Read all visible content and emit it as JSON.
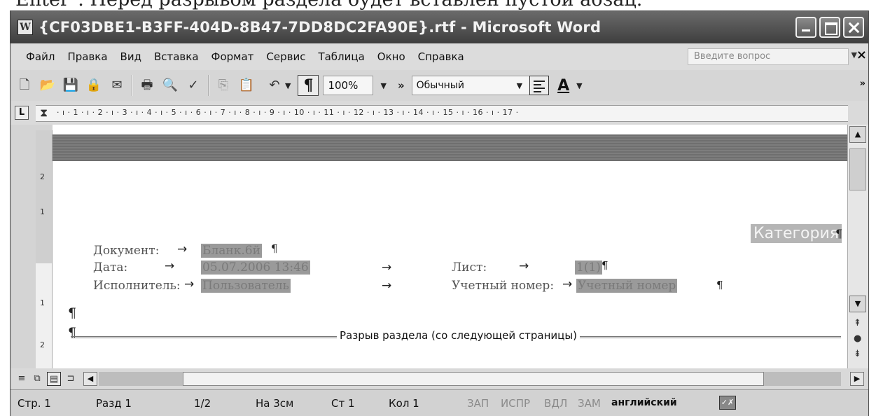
{
  "book_line": "Enter\". Перед разрывом раздела будет вставлен пустой абзац.",
  "window": {
    "title": "{CF03DBE1-B3FF-404D-8B47-7DD8DC2FA90E}.rtf - Microsoft Word",
    "icon": "word-document-icon"
  },
  "menu": {
    "items": [
      "Файл",
      "Правка",
      "Вид",
      "Вставка",
      "Формат",
      "Сервис",
      "Таблица",
      "Окно",
      "Справка"
    ],
    "help_placeholder": "Введите вопрос"
  },
  "toolbar": {
    "zoom": "100%",
    "style": "Обычный"
  },
  "ruler": {
    "marks": "· ı · 1 · ı · 2 · ı · 3 · ı · 4 · ı · 5 · ı · 6 · ı · 7 · ı · 8 · ı · 9 · ı · 10 · ı · 11 · ı · 12 · ı · 13 · ı · 14 · ı · 15 · ı · 16 · ı · 17 ·"
  },
  "document": {
    "category": "Категория",
    "rows": {
      "doc_label": "Документ:",
      "doc_value": "Бланк.6й",
      "date_label": "Дата:",
      "date_value": "05.07.2006 13:46",
      "sheet_label": "Лист:",
      "sheet_value": "1(1)",
      "exec_label": "Исполнитель:",
      "exec_value": "Пользователь",
      "acct_label": "Учетный номер:",
      "acct_value": "Учетный номер"
    },
    "section_break": "Разрыв раздела (со следующей страницы)"
  },
  "status": {
    "page": "Стр. 1",
    "section": "Разд 1",
    "pages": "1/2",
    "at": "На 3см",
    "line": "Ст 1",
    "col": "Кол 1",
    "rec": "ЗАП",
    "trk": "ИСПР",
    "ext": "ВДЛ",
    "ovr": "ЗАМ",
    "lang": "английский"
  }
}
